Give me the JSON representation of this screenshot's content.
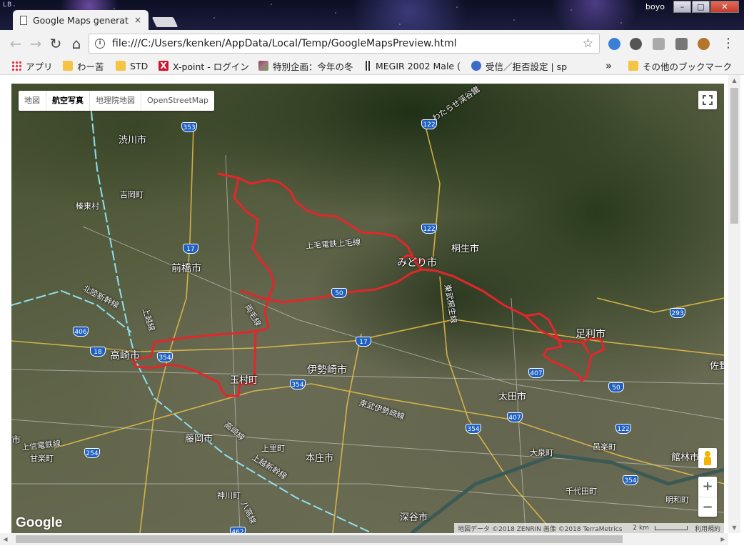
{
  "window": {
    "tab_title": "Google Maps generate",
    "tab_close": "×",
    "profile_name": "boyo",
    "minimize": "–",
    "maximize": "□",
    "close": "✕"
  },
  "toolbar": {
    "back": "←",
    "forward": "→",
    "reload": "↻",
    "home": "⌂",
    "info": "i",
    "url": "file:///C:/Users/kenken/AppData/Local/Temp/GoogleMapsPreview.html",
    "bookmark_star": "☆",
    "menu": "⋮"
  },
  "bookmarks": {
    "items": [
      {
        "label": "アプリ",
        "icon": "apps-grid-icon"
      },
      {
        "label": "わー苦",
        "icon": "folder-icon"
      },
      {
        "label": "STD",
        "icon": "folder-icon"
      },
      {
        "label": "X-point - ログイン",
        "icon": "x-point-icon"
      },
      {
        "label": "特別企画：今年の冬",
        "icon": "site-image-icon"
      },
      {
        "label": "MEGIR 2002 Male (",
        "icon": "barcode-icon"
      },
      {
        "label": "受信／拒否設定 | sp",
        "icon": "site-circle-icon"
      }
    ],
    "overflow": "»",
    "other": "その他のブックマーク"
  },
  "map": {
    "map_types": [
      "地図",
      "航空写真",
      "地理院地図",
      "OpenStreetMap"
    ],
    "active_map_type": "航空写真",
    "zoom_in": "+",
    "zoom_out": "−",
    "logo": "Google",
    "attribution": "地図データ ©2018 ZENRIN 画像 ©2018 TerraMetrics",
    "scale": "2 km",
    "terms": "利用規約",
    "route_color": "#e3262b",
    "place_labels": [
      {
        "text": "渋川市"
      },
      {
        "text": "吉岡町"
      },
      {
        "text": "榛東村"
      },
      {
        "text": "前橋市"
      },
      {
        "text": "高崎市"
      },
      {
        "text": "玉村町"
      },
      {
        "text": "伊勢崎市"
      },
      {
        "text": "みどり市"
      },
      {
        "text": "桐生市"
      },
      {
        "text": "足利市"
      },
      {
        "text": "太田市"
      },
      {
        "text": "藤岡市"
      },
      {
        "text": "本庄市"
      },
      {
        "text": "上里町"
      },
      {
        "text": "深谷市"
      },
      {
        "text": "大泉町"
      },
      {
        "text": "邑楽町"
      },
      {
        "text": "千代田町"
      },
      {
        "text": "館林市"
      },
      {
        "text": "明和町"
      },
      {
        "text": "神川町"
      },
      {
        "text": "甘楽町"
      },
      {
        "text": "佐野"
      },
      {
        "text": "わたらせ渓谷鐵"
      },
      {
        "text": "上毛電鉄上毛線"
      },
      {
        "text": "北陸新幹線"
      },
      {
        "text": "上越線"
      },
      {
        "text": "両毛線"
      },
      {
        "text": "東武桐生線"
      },
      {
        "text": "東武伊勢崎線"
      },
      {
        "text": "上信電鉄線"
      },
      {
        "text": "上越新幹線"
      },
      {
        "text": "高崎線"
      },
      {
        "text": "八高線"
      },
      {
        "text": "市"
      }
    ],
    "route_shields": [
      "353",
      "122",
      "122",
      "17",
      "50",
      "406",
      "18",
      "354",
      "17",
      "354",
      "407",
      "407",
      "354",
      "293",
      "122",
      "354",
      "50",
      "254",
      "462"
    ]
  }
}
